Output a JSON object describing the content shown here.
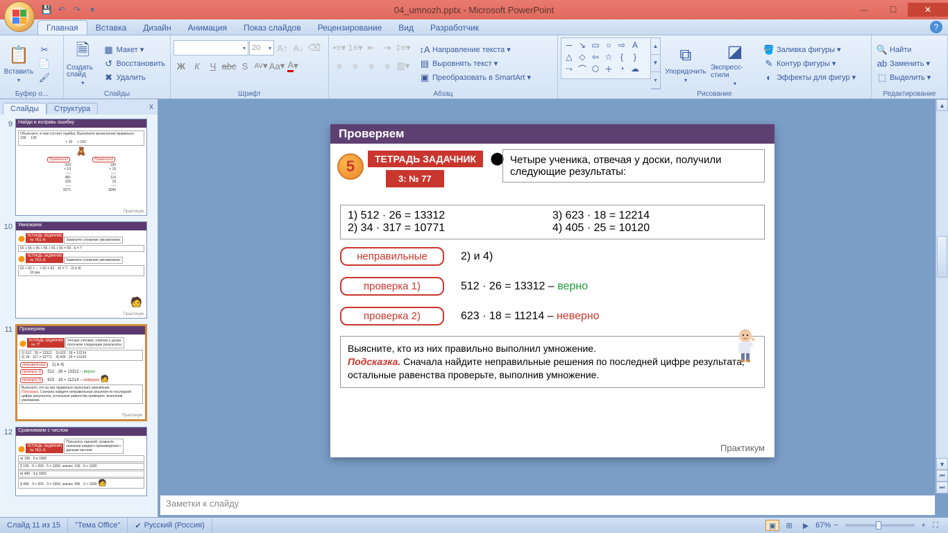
{
  "app_title": "04_umnozh.pptx - Microsoft PowerPoint",
  "qa": {
    "save": "💾",
    "undo": "↶",
    "redo": "↷",
    "more": "▾"
  },
  "win": {
    "min": "—",
    "max": "☐",
    "close": "✕"
  },
  "tabs": [
    "Главная",
    "Вставка",
    "Дизайн",
    "Анимация",
    "Показ слайдов",
    "Рецензирование",
    "Вид",
    "Разработчик"
  ],
  "active_tab": 0,
  "ribbon": {
    "clipboard": {
      "label": "Буфер о...",
      "paste": "Вставить",
      "cut": "✂",
      "copy": "📄",
      "format": "🖌"
    },
    "slides": {
      "label": "Слайды",
      "new": "Создать слайд",
      "layout": "Макет",
      "reset": "Восстановить",
      "delete": "Удалить"
    },
    "font": {
      "label": "Шрифт",
      "size": "20",
      "bold": "Ж",
      "italic": "К",
      "underline": "Ч",
      "strike": "abc",
      "shadow": "S",
      "spacing": "AV",
      "case": "Aa",
      "grow": "A",
      "shrink": "A",
      "clear": "⌫",
      "color": "A"
    },
    "paragraph": {
      "label": "Абзац",
      "dir": "Направление текста",
      "align_t": "Выровнять текст",
      "smartart": "Преобразовать в SmartArt"
    },
    "drawing": {
      "label": "Рисование",
      "arrange": "Упорядочить",
      "styles": "Экспресс-стили",
      "fill": "Заливка фигуры",
      "outline": "Контур фигуры",
      "effects": "Эффекты для фигур"
    },
    "editing": {
      "label": "Редактирование",
      "find": "Найти",
      "replace": "Заменить",
      "select": "Выделить"
    }
  },
  "pane": {
    "tab1": "Слайды",
    "tab2": "Структура",
    "close": "x"
  },
  "thumbs": [
    {
      "num": "9",
      "title": "Найди и исправь ошибку",
      "corner": "Практикум"
    },
    {
      "num": "10",
      "title": "Умножаем",
      "corner": "Практикум"
    },
    {
      "num": "11",
      "title": "Проверяем",
      "corner": "Практикум"
    },
    {
      "num": "12",
      "title": "Сравниваем с числом",
      "corner": "Практикум"
    }
  ],
  "slide": {
    "header": "Проверяем",
    "badge": "5",
    "workbook": "ТЕТРАДЬ ЗАДАЧНИК",
    "task_no": "3: № 77",
    "intro": "Четыре ученика, отвечая у доски, получили следующие результаты:",
    "p1": "1)   512 · 26 = 13312",
    "p3": "3) 623 · 18 = 12214",
    "p2": "2)   34 · 317 = 10771",
    "p4": "4) 405 · 25 = 10120",
    "btn_wrong": "неправильные",
    "ans_wrong": "2) и 4)",
    "btn_c1": "проверка 1)",
    "ans1a": "512 · 26 = 13312 – ",
    "ans1b": "верно",
    "btn_c2": "проверка 2)",
    "ans2a": "623 · 18 = 11214 – ",
    "ans2b": "неверно",
    "hint_q": "Выясните, кто из них правильно выполнил умножение.",
    "hint_label": "Подсказка.",
    "hint_t": " Сначала найдите неправильные решения по последней цифре результата; остальные равенства проверьте, выполнив умножение.",
    "corner": "Практикум"
  },
  "notes_placeholder": "Заметки к слайду",
  "status": {
    "slide": "Слайд 11 из 15",
    "theme": "\"Тема Office\"",
    "lang": "Русский (Россия)",
    "zoom": "67%"
  }
}
